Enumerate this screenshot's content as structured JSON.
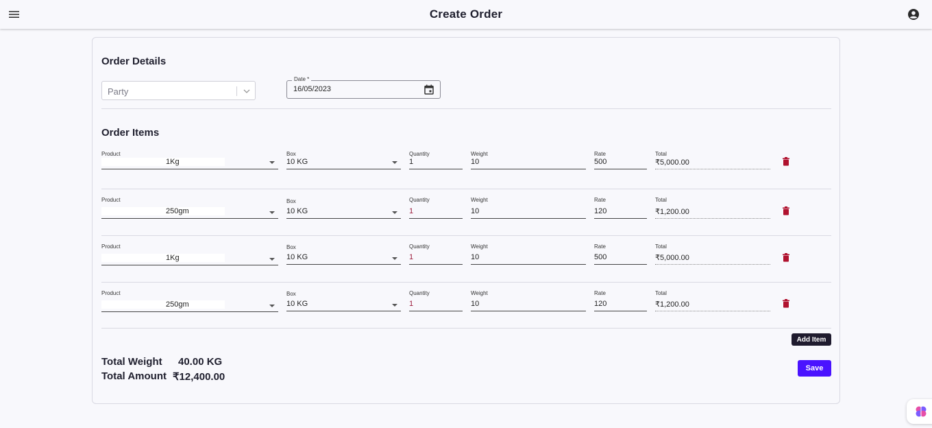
{
  "header": {
    "title": "Create Order",
    "menu_icon": "menu-icon",
    "account_icon": "account-circle-icon"
  },
  "order_details": {
    "title": "Order Details",
    "party_placeholder": "Party",
    "date_label": "Date *",
    "date_value": "16/05/2023"
  },
  "order_items": {
    "title": "Order Items",
    "labels": {
      "product": "Product",
      "box": "Box",
      "quantity": "Quantity",
      "weight": "Weight",
      "rate": "Rate",
      "total": "Total"
    },
    "rows": [
      {
        "product": "1Kg",
        "box": "10 KG",
        "quantity": "1",
        "weight": "10",
        "rate": "500",
        "total": "₹5,000.00"
      },
      {
        "product": "250gm",
        "box": "10 KG",
        "quantity": "1",
        "weight": "10",
        "rate": "120",
        "total": "₹1,200.00"
      },
      {
        "product": "1Kg",
        "box": "10 KG",
        "quantity": "1",
        "weight": "10",
        "rate": "500",
        "total": "₹5,000.00"
      },
      {
        "product": "250gm",
        "box": "10 KG",
        "quantity": "1",
        "weight": "10",
        "rate": "120",
        "total": "₹1,200.00"
      }
    ],
    "add_item_label": "Add Item"
  },
  "summary": {
    "total_weight_label": "Total Weight",
    "total_weight_value": "40.00 KG",
    "total_amount_label": "Total Amount",
    "total_amount_value": "₹12,400.00"
  },
  "actions": {
    "save_label": "Save"
  },
  "colors": {
    "accent": "#4a13ff",
    "dark_button": "#1f1b2e",
    "delete": "#b0122f",
    "background": "#f8f8fc"
  }
}
